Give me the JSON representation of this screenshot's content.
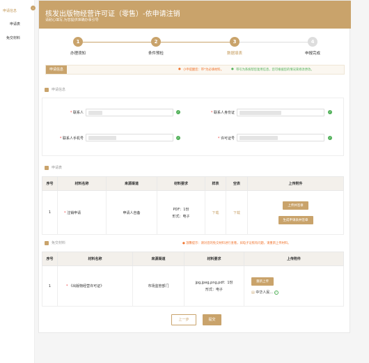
{
  "nav": {
    "items": [
      {
        "label": "申请信息",
        "active": true
      },
      {
        "label": "申请表",
        "active": false
      },
      {
        "label": "免交材料",
        "active": false
      }
    ],
    "toggle_icon": "chevron-right-icon"
  },
  "header": {
    "title": "核发出版物经营许可证（零售）-依申请注销",
    "subtitle": "请耐心填写,为您提供准确办事引导"
  },
  "steps": [
    {
      "num": "1",
      "label": "办理须知",
      "state": "done"
    },
    {
      "num": "2",
      "label": "条件预检",
      "state": "done"
    },
    {
      "num": "3",
      "label": "数据填表",
      "state": "active"
    },
    {
      "num": "4",
      "label": "申报完成",
      "state": "todo"
    }
  ],
  "tipbar": {
    "tag": "申请信息",
    "tip1": "小申提醒您：带*为必填材料。",
    "tip2": "带号为系统帮您复用信息，您可根据您的情况来修改更改。"
  },
  "applicant": {
    "section_title": "申请信息",
    "fields": [
      {
        "label": "联系人",
        "required": true
      },
      {
        "label": "联系人身份证",
        "required": true
      },
      {
        "label": "联系人手机号",
        "required": true
      },
      {
        "label": "许可证号",
        "required": true
      }
    ]
  },
  "form_table": {
    "section_title": "申请表",
    "headers": [
      "序号",
      "材料名称",
      "来源渠道",
      "材料要求",
      "样表",
      "空表",
      "上传附件"
    ],
    "rows": [
      {
        "index": "1",
        "name": "注销申请",
        "source": "申请人自备",
        "requirement_line1": "PDF：1份",
        "requirement_line2": "形式：电子",
        "sample": "下载",
        "blank": "下载",
        "upload_btn": "上传并签章",
        "generate_btn": "生成申请表并签章"
      }
    ]
  },
  "free_materials": {
    "section_title": "免交材料",
    "tip": "温馨提示：请对您的免交材料进行查看，如电子证照有问题，请重新上传材料。",
    "headers": [
      "序号",
      "材料名称",
      "来源渠道",
      "材料要求",
      "上传附件"
    ],
    "rows": [
      {
        "index": "1",
        "name": "《出版物经营许可证》",
        "source": "市场监管部门",
        "requirement_line1": "jpg,jpeg,png,pdf：1份",
        "requirement_line2": "形式：电子",
        "upload_btn": "重新上传",
        "file_name": "中华人民..."
      }
    ]
  },
  "actions": {
    "prev": "上一步",
    "submit": "提交"
  },
  "colors": {
    "brand": "#c9a36b",
    "ok": "#52b15a",
    "warn": "#f0732c"
  }
}
